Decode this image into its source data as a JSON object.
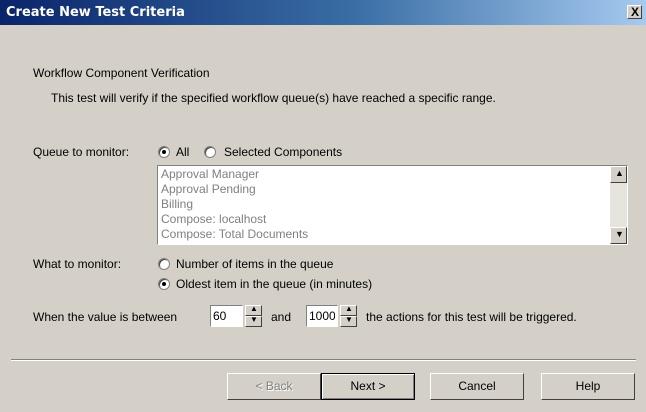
{
  "window": {
    "title": "Create New Test Criteria",
    "close_label": "X"
  },
  "header": {
    "heading": "Workflow Component Verification",
    "description": "This test will verify if the specified workflow queue(s) have reached a specific range."
  },
  "queue": {
    "label": "Queue to monitor:",
    "options": [
      {
        "label": "All",
        "selected": true
      },
      {
        "label": "Selected Components",
        "selected": false
      }
    ],
    "list_items": [
      "Approval Manager",
      "Approval Pending",
      "Billing",
      "Compose: localhost",
      "Compose: Total Documents"
    ]
  },
  "monitor": {
    "label": "What to monitor:",
    "options": [
      {
        "label": "Number of items in the queue",
        "selected": false
      },
      {
        "label": "Oldest item in the queue (in minutes)",
        "selected": true
      }
    ]
  },
  "range": {
    "prefix": "When the value is between",
    "min_value": "60",
    "connector": "and",
    "max_value": "1000",
    "suffix": "the actions for this test will be triggered."
  },
  "buttons": {
    "back": "< Back",
    "next": "Next >",
    "cancel": "Cancel",
    "help": "Help"
  },
  "colors": {
    "titlebar_start": "#0a246a",
    "titlebar_end": "#a6caf0",
    "dialog_bg": "#d4d0c8"
  }
}
